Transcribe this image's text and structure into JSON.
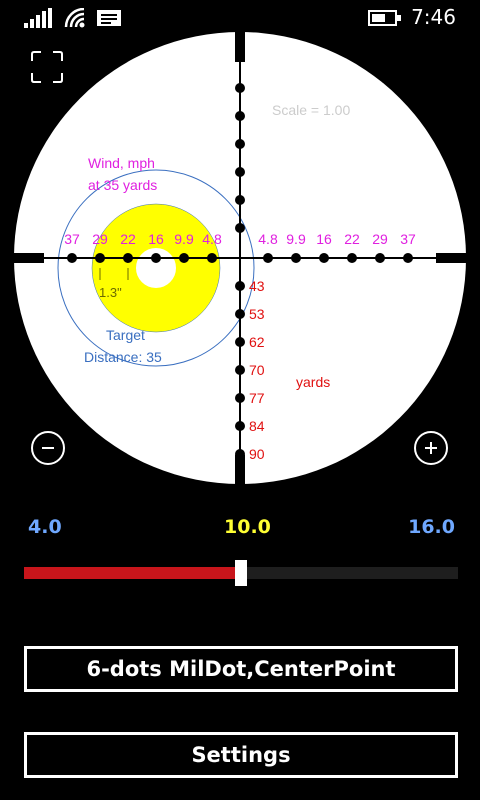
{
  "status_bar": {
    "time": "7:46",
    "icons": [
      "signal-icon",
      "wifi-icon",
      "message-icon",
      "battery-icon"
    ]
  },
  "reticle": {
    "scale_label": "Scale = 1.00",
    "wind_label_line1": "Wind, mph",
    "wind_label_line2": "at 35 yards",
    "wind_values_left": [
      "37",
      "29",
      "22",
      "16",
      "9.9",
      "4.8"
    ],
    "wind_values_right": [
      "4.8",
      "9.9",
      "16",
      "22",
      "29",
      "37"
    ],
    "range_values": [
      "43",
      "53",
      "62",
      "70",
      "77",
      "84",
      "90"
    ],
    "range_unit": "yards",
    "target_size": "1.3\"",
    "target_label_line1": "Target",
    "target_label_line2": "Distance: 35",
    "colors": {
      "wind_text": "#e020e0",
      "range_text": "#e01010",
      "target_fill": "#ffff00",
      "target_text": "#3a6fc0",
      "scale_text": "#cccccc",
      "background": "#ffffff"
    }
  },
  "zoom": {
    "min_label": "4.0",
    "current_label": "10.0",
    "max_label": "16.0",
    "min": 4.0,
    "value": 10.0,
    "max": 16.0
  },
  "buttons": {
    "reticle_select": "6-dots MilDot,CenterPoint",
    "settings": "Settings"
  }
}
